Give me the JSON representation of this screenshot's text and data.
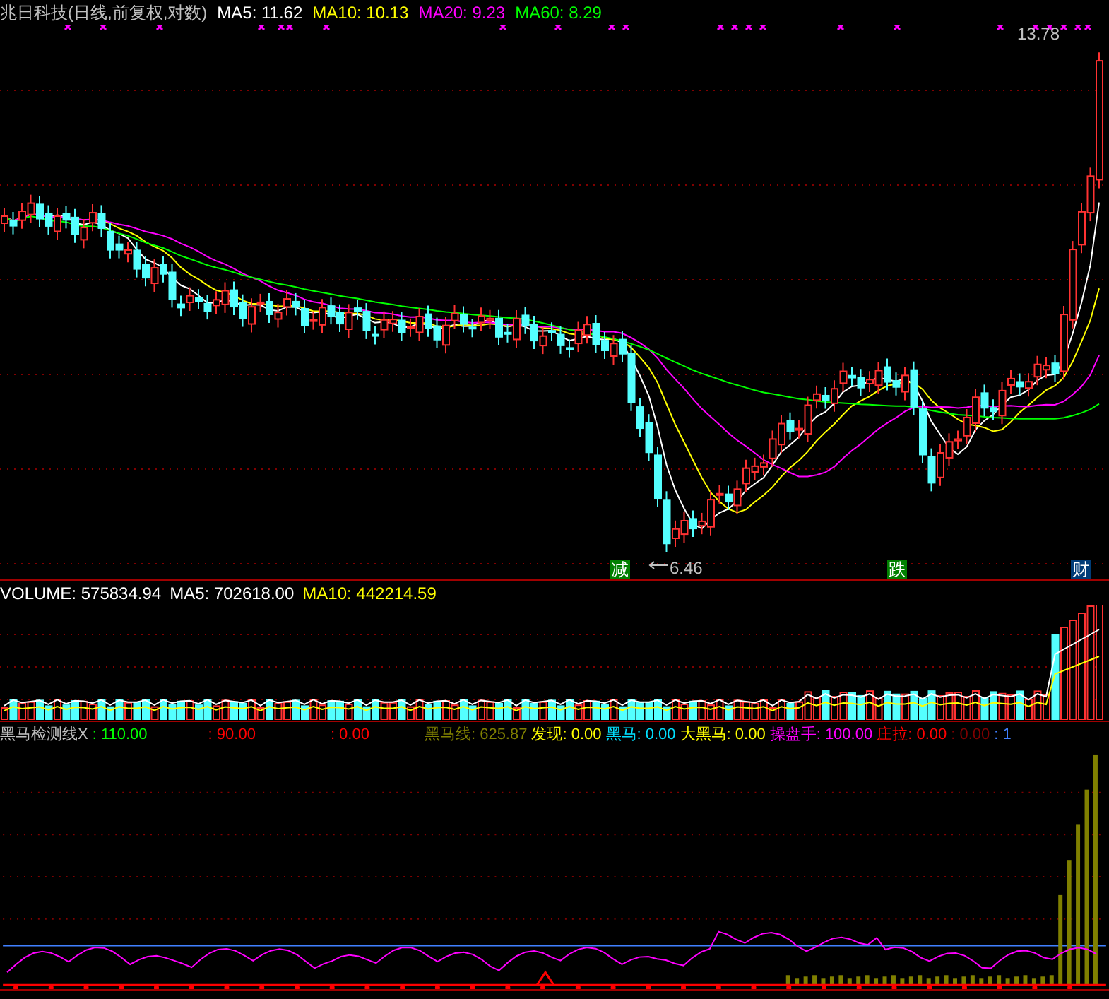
{
  "price_panel": {
    "title": "兆日科技(日线,前复权,对数)",
    "indicators": [
      {
        "label": "MA5: 11.62",
        "color": "#ffffff"
      },
      {
        "label": "MA10: 10.13",
        "color": "#ffff00"
      },
      {
        "label": "MA20: 9.23",
        "color": "#ff00ff"
      },
      {
        "label": "MA60: 8.29",
        "color": "#00ff00"
      }
    ],
    "high_label": "13.78",
    "low_label": "6.46",
    "signals": [
      {
        "text": "减",
        "color": "#008000"
      },
      {
        "text": "跌",
        "color": "#008000"
      },
      {
        "text": "财",
        "color": "#003c78"
      }
    ]
  },
  "volume_panel": {
    "indicators": [
      {
        "label": "VOLUME: 575834.94",
        "color": "#ffffff"
      },
      {
        "label": "MA5: 702618.00",
        "color": "#ffffff"
      },
      {
        "label": "MA10: 442214.59",
        "color": "#ffff00"
      }
    ]
  },
  "indicator_panel": {
    "title": "黑马检测线X",
    "indicators": [
      {
        "label": ": 110.00",
        "color": "#00ff00"
      },
      {
        "label": ": 90.00",
        "color": "#ff0000"
      },
      {
        "label": ": 0.00",
        "color": "#ff0000"
      },
      {
        "label": "黑马线: 625.87",
        "color": "#808000"
      },
      {
        "label": "发现: 0.00",
        "color": "#ffff00"
      },
      {
        "label": "黑马: 0.00",
        "color": "#00e0ff"
      },
      {
        "label": "大黑马: 0.00",
        "color": "#ffff00"
      },
      {
        "label": "操盘手: 100.00",
        "color": "#ff00ff"
      },
      {
        "label": "庄拉: 0.00",
        "color": "#ff0000"
      },
      {
        "label": ": 0.00",
        "color": "#800000"
      },
      {
        "label": ": 1",
        "color": "#4080ff"
      }
    ]
  }
}
